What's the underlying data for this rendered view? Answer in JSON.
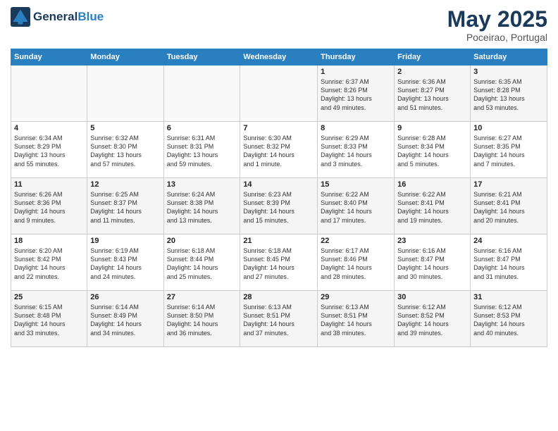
{
  "header": {
    "logo_line1": "General",
    "logo_line2": "Blue",
    "month": "May 2025",
    "location": "Poceirao, Portugal"
  },
  "weekdays": [
    "Sunday",
    "Monday",
    "Tuesday",
    "Wednesday",
    "Thursday",
    "Friday",
    "Saturday"
  ],
  "weeks": [
    [
      {
        "day": "",
        "info": ""
      },
      {
        "day": "",
        "info": ""
      },
      {
        "day": "",
        "info": ""
      },
      {
        "day": "",
        "info": ""
      },
      {
        "day": "1",
        "info": "Sunrise: 6:37 AM\nSunset: 8:26 PM\nDaylight: 13 hours\nand 49 minutes."
      },
      {
        "day": "2",
        "info": "Sunrise: 6:36 AM\nSunset: 8:27 PM\nDaylight: 13 hours\nand 51 minutes."
      },
      {
        "day": "3",
        "info": "Sunrise: 6:35 AM\nSunset: 8:28 PM\nDaylight: 13 hours\nand 53 minutes."
      }
    ],
    [
      {
        "day": "4",
        "info": "Sunrise: 6:34 AM\nSunset: 8:29 PM\nDaylight: 13 hours\nand 55 minutes."
      },
      {
        "day": "5",
        "info": "Sunrise: 6:32 AM\nSunset: 8:30 PM\nDaylight: 13 hours\nand 57 minutes."
      },
      {
        "day": "6",
        "info": "Sunrise: 6:31 AM\nSunset: 8:31 PM\nDaylight: 13 hours\nand 59 minutes."
      },
      {
        "day": "7",
        "info": "Sunrise: 6:30 AM\nSunset: 8:32 PM\nDaylight: 14 hours\nand 1 minute."
      },
      {
        "day": "8",
        "info": "Sunrise: 6:29 AM\nSunset: 8:33 PM\nDaylight: 14 hours\nand 3 minutes."
      },
      {
        "day": "9",
        "info": "Sunrise: 6:28 AM\nSunset: 8:34 PM\nDaylight: 14 hours\nand 5 minutes."
      },
      {
        "day": "10",
        "info": "Sunrise: 6:27 AM\nSunset: 8:35 PM\nDaylight: 14 hours\nand 7 minutes."
      }
    ],
    [
      {
        "day": "11",
        "info": "Sunrise: 6:26 AM\nSunset: 8:36 PM\nDaylight: 14 hours\nand 9 minutes."
      },
      {
        "day": "12",
        "info": "Sunrise: 6:25 AM\nSunset: 8:37 PM\nDaylight: 14 hours\nand 11 minutes."
      },
      {
        "day": "13",
        "info": "Sunrise: 6:24 AM\nSunset: 8:38 PM\nDaylight: 14 hours\nand 13 minutes."
      },
      {
        "day": "14",
        "info": "Sunrise: 6:23 AM\nSunset: 8:39 PM\nDaylight: 14 hours\nand 15 minutes."
      },
      {
        "day": "15",
        "info": "Sunrise: 6:22 AM\nSunset: 8:40 PM\nDaylight: 14 hours\nand 17 minutes."
      },
      {
        "day": "16",
        "info": "Sunrise: 6:22 AM\nSunset: 8:41 PM\nDaylight: 14 hours\nand 19 minutes."
      },
      {
        "day": "17",
        "info": "Sunrise: 6:21 AM\nSunset: 8:41 PM\nDaylight: 14 hours\nand 20 minutes."
      }
    ],
    [
      {
        "day": "18",
        "info": "Sunrise: 6:20 AM\nSunset: 8:42 PM\nDaylight: 14 hours\nand 22 minutes."
      },
      {
        "day": "19",
        "info": "Sunrise: 6:19 AM\nSunset: 8:43 PM\nDaylight: 14 hours\nand 24 minutes."
      },
      {
        "day": "20",
        "info": "Sunrise: 6:18 AM\nSunset: 8:44 PM\nDaylight: 14 hours\nand 25 minutes."
      },
      {
        "day": "21",
        "info": "Sunrise: 6:18 AM\nSunset: 8:45 PM\nDaylight: 14 hours\nand 27 minutes."
      },
      {
        "day": "22",
        "info": "Sunrise: 6:17 AM\nSunset: 8:46 PM\nDaylight: 14 hours\nand 28 minutes."
      },
      {
        "day": "23",
        "info": "Sunrise: 6:16 AM\nSunset: 8:47 PM\nDaylight: 14 hours\nand 30 minutes."
      },
      {
        "day": "24",
        "info": "Sunrise: 6:16 AM\nSunset: 8:47 PM\nDaylight: 14 hours\nand 31 minutes."
      }
    ],
    [
      {
        "day": "25",
        "info": "Sunrise: 6:15 AM\nSunset: 8:48 PM\nDaylight: 14 hours\nand 33 minutes."
      },
      {
        "day": "26",
        "info": "Sunrise: 6:14 AM\nSunset: 8:49 PM\nDaylight: 14 hours\nand 34 minutes."
      },
      {
        "day": "27",
        "info": "Sunrise: 6:14 AM\nSunset: 8:50 PM\nDaylight: 14 hours\nand 36 minutes."
      },
      {
        "day": "28",
        "info": "Sunrise: 6:13 AM\nSunset: 8:51 PM\nDaylight: 14 hours\nand 37 minutes."
      },
      {
        "day": "29",
        "info": "Sunrise: 6:13 AM\nSunset: 8:51 PM\nDaylight: 14 hours\nand 38 minutes."
      },
      {
        "day": "30",
        "info": "Sunrise: 6:12 AM\nSunset: 8:52 PM\nDaylight: 14 hours\nand 39 minutes."
      },
      {
        "day": "31",
        "info": "Sunrise: 6:12 AM\nSunset: 8:53 PM\nDaylight: 14 hours\nand 40 minutes."
      }
    ]
  ]
}
